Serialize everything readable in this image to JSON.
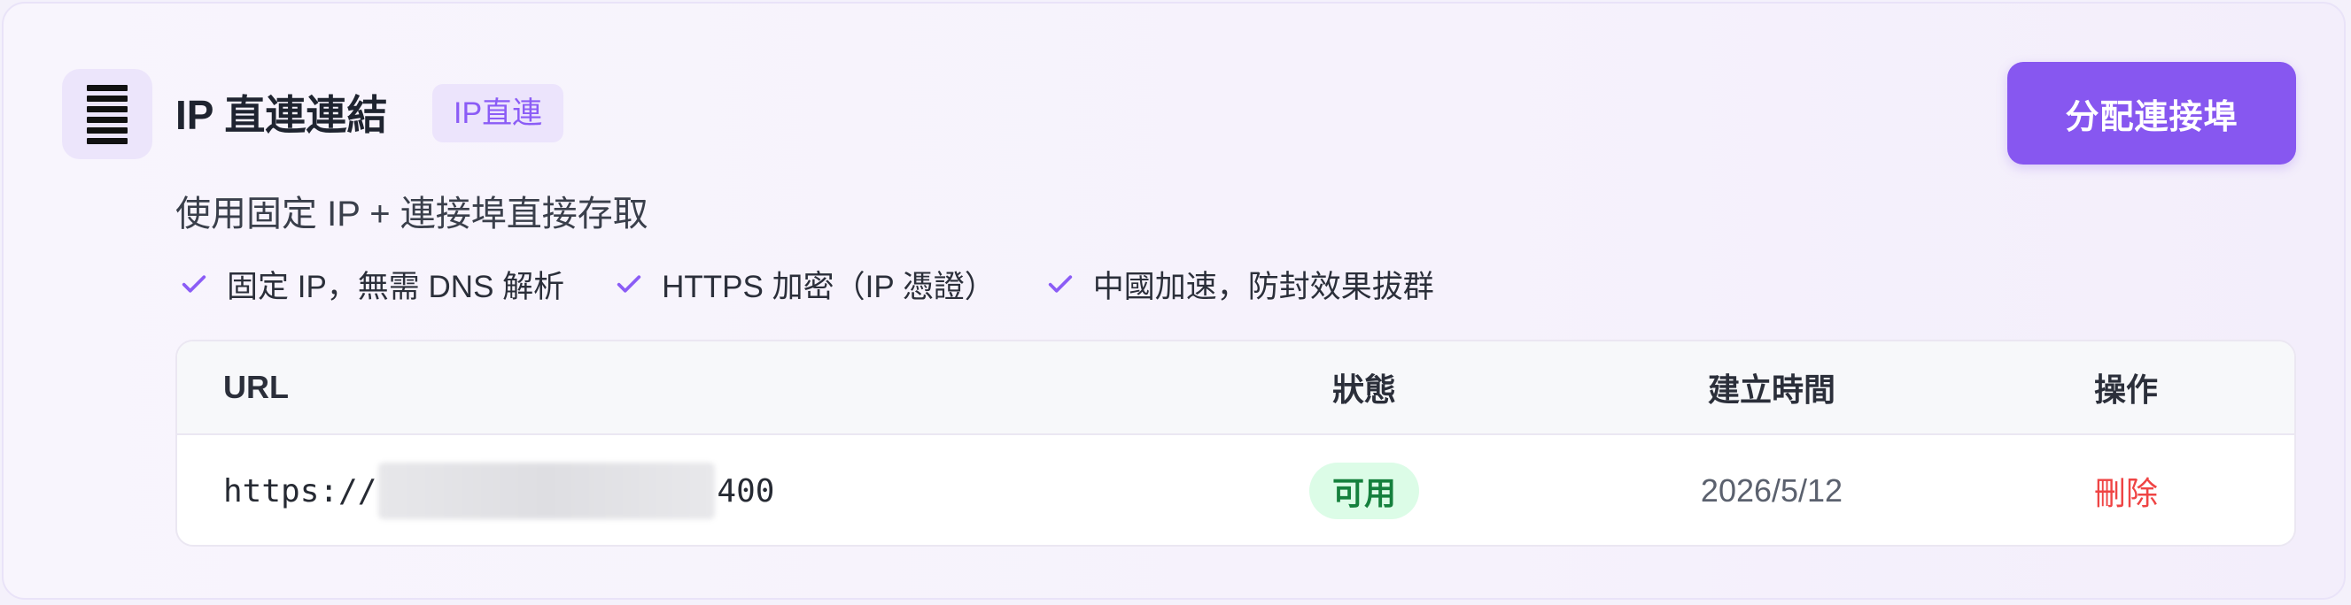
{
  "header": {
    "icon": "list-bars-icon",
    "title": "IP 直連連結",
    "tag": "IP直連",
    "assign_button": "分配連接埠"
  },
  "subtitle": "使用固定 IP + 連接埠直接存取",
  "features": [
    {
      "icon": "check-icon",
      "label": "固定 IP，無需 DNS 解析"
    },
    {
      "icon": "check-icon",
      "label": "HTTPS 加密（IP 憑證）"
    },
    {
      "icon": "check-icon",
      "label": "中國加速，防封效果拔群"
    }
  ],
  "table": {
    "columns": [
      "URL",
      "狀態",
      "建立時間",
      "操作"
    ],
    "rows": [
      {
        "url_prefix": "https://",
        "url_suffix": "400",
        "status": "可用",
        "created": "2026/5/12",
        "action": "刪除"
      }
    ]
  },
  "colors": {
    "accent": "#8757f0",
    "tag_text": "#8b5cf6",
    "status_bg": "#dcfce7",
    "status_text": "#15803d",
    "danger": "#ef4444"
  }
}
